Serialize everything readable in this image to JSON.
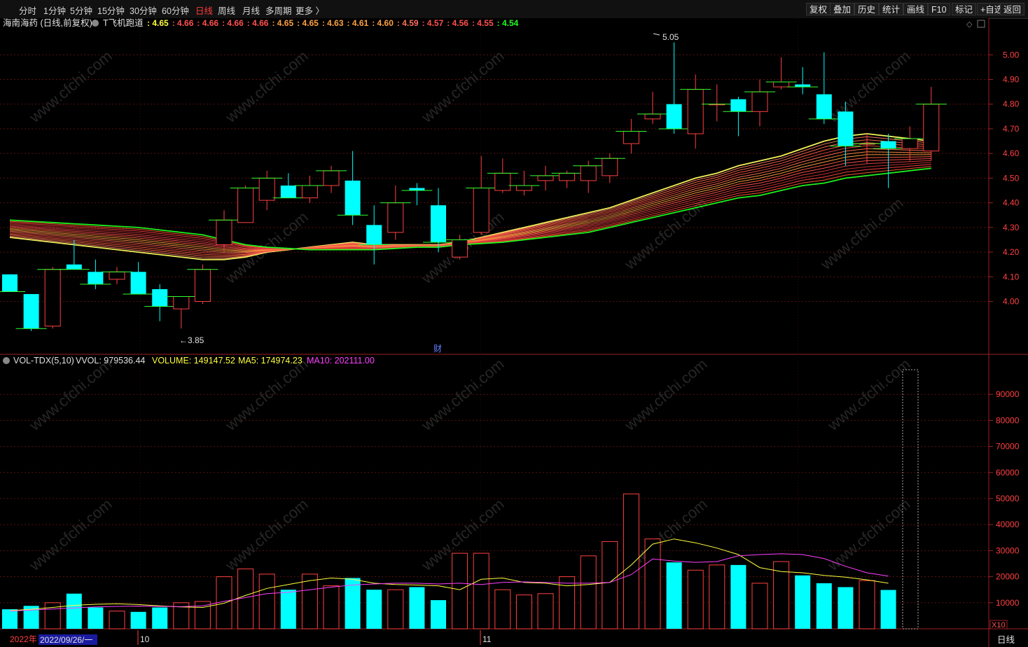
{
  "toolbar": {
    "periods": [
      "分时",
      "1分钟",
      "5分钟",
      "15分钟",
      "30分钟",
      "60分钟",
      "日线",
      "周线",
      "月线",
      "多周期",
      "更多 〉"
    ],
    "active_period": "日线",
    "right_buttons": [
      "复权",
      "叠加",
      "历史",
      "统计",
      "画线",
      "F10",
      "标记",
      "+自选",
      "返回"
    ]
  },
  "main_header": {
    "stock": "海南海药 (日线,前复权)",
    "indicator": "T飞机跑道",
    "values": [
      {
        "v": ": 4.65",
        "color": "#ffff40"
      },
      {
        "v": ": 4.66",
        "color": "#ff5050"
      },
      {
        "v": ": 4.66",
        "color": "#ff5050"
      },
      {
        "v": ": 4.66",
        "color": "#ff5050"
      },
      {
        "v": ": 4.66",
        "color": "#ff5050"
      },
      {
        "v": ": 4.65",
        "color": "#ffa040"
      },
      {
        "v": ": 4.65",
        "color": "#ffa040"
      },
      {
        "v": ": 4.63",
        "color": "#ffa040"
      },
      {
        "v": ": 4.61",
        "color": "#ffa040"
      },
      {
        "v": ": 4.60",
        "color": "#ffa040"
      },
      {
        "v": ": 4.59",
        "color": "#ff7060"
      },
      {
        "v": ": 4.57",
        "color": "#ff5050"
      },
      {
        "v": ": 4.56",
        "color": "#ff5050"
      },
      {
        "v": ": 4.55",
        "color": "#ff5050"
      },
      {
        "v": ": 4.54",
        "color": "#20ff20"
      }
    ]
  },
  "vol_header": {
    "name": "VOL-TDX(5,10)",
    "vvol": "VVOL: 979536.44",
    "volume": "VOLUME: 149147.52",
    "ma5": "MA5: 174974.23",
    "ma10": "MA10: 202111.00"
  },
  "annotations": {
    "high_label": "5.05",
    "low_label": "←3.85",
    "cai_marker": "财",
    "xscale": "X10"
  },
  "footer": {
    "year": "2022年",
    "date": "2022/09/26/一",
    "oct": "10",
    "nov": "11",
    "period_btn": "日线"
  },
  "colors": {
    "up": "#ff4040",
    "down": "#00ffff",
    "ma5": "#ffff40",
    "ma10": "#ff40ff",
    "fast_line": "#ffff60",
    "slow_line": "#20ff20"
  },
  "chart_data": [
    {
      "type": "candlestick",
      "ylim": [
        3.8,
        5.12
      ],
      "yticks": [
        4.0,
        4.1,
        4.2,
        4.3,
        4.4,
        4.5,
        4.6,
        4.7,
        4.8,
        4.9,
        5.0
      ],
      "candles": [
        {
          "o": 4.11,
          "h": 4.11,
          "l": 4.04,
          "c": 4.04
        },
        {
          "o": 4.03,
          "h": 4.03,
          "l": 3.88,
          "c": 3.89
        },
        {
          "o": 3.9,
          "h": 4.14,
          "l": 3.89,
          "c": 4.13
        },
        {
          "o": 4.15,
          "h": 4.25,
          "l": 4.13,
          "c": 4.13
        },
        {
          "o": 4.12,
          "h": 4.17,
          "l": 4.05,
          "c": 4.07
        },
        {
          "o": 4.09,
          "h": 4.14,
          "l": 4.07,
          "c": 4.12
        },
        {
          "o": 4.12,
          "h": 4.16,
          "l": 4.03,
          "c": 4.03
        },
        {
          "o": 4.05,
          "h": 4.07,
          "l": 3.92,
          "c": 3.98
        },
        {
          "o": 3.97,
          "h": 4.02,
          "l": 3.89,
          "c": 4.02
        },
        {
          "o": 4.0,
          "h": 4.15,
          "l": 3.99,
          "c": 4.13
        },
        {
          "o": 4.23,
          "h": 4.37,
          "l": 4.2,
          "c": 4.33
        },
        {
          "o": 4.32,
          "h": 4.47,
          "l": 4.32,
          "c": 4.46
        },
        {
          "o": 4.41,
          "h": 4.53,
          "l": 4.37,
          "c": 4.5
        },
        {
          "o": 4.47,
          "h": 4.52,
          "l": 4.42,
          "c": 4.42
        },
        {
          "o": 4.42,
          "h": 4.51,
          "l": 4.4,
          "c": 4.47
        },
        {
          "o": 4.47,
          "h": 4.55,
          "l": 4.44,
          "c": 4.53
        },
        {
          "o": 4.49,
          "h": 4.61,
          "l": 4.31,
          "c": 4.35
        },
        {
          "o": 4.31,
          "h": 4.39,
          "l": 4.15,
          "c": 4.23
        },
        {
          "o": 4.28,
          "h": 4.47,
          "l": 4.25,
          "c": 4.4
        },
        {
          "o": 4.46,
          "h": 4.48,
          "l": 4.39,
          "c": 4.45
        },
        {
          "o": 4.39,
          "h": 4.46,
          "l": 4.2,
          "c": 4.24
        },
        {
          "o": 4.18,
          "h": 4.27,
          "l": 4.17,
          "c": 4.25
        },
        {
          "o": 4.28,
          "h": 4.59,
          "l": 4.27,
          "c": 4.46
        },
        {
          "o": 4.45,
          "h": 4.58,
          "l": 4.44,
          "c": 4.52
        },
        {
          "o": 4.45,
          "h": 4.53,
          "l": 4.43,
          "c": 4.47
        },
        {
          "o": 4.49,
          "h": 4.55,
          "l": 4.45,
          "c": 4.51
        },
        {
          "o": 4.49,
          "h": 4.53,
          "l": 4.46,
          "c": 4.52
        },
        {
          "o": 4.49,
          "h": 4.57,
          "l": 4.44,
          "c": 4.55
        },
        {
          "o": 4.51,
          "h": 4.6,
          "l": 4.48,
          "c": 4.58
        },
        {
          "o": 4.64,
          "h": 4.74,
          "l": 4.6,
          "c": 4.69
        },
        {
          "o": 4.74,
          "h": 4.85,
          "l": 4.72,
          "c": 4.76
        },
        {
          "o": 4.8,
          "h": 5.05,
          "l": 4.68,
          "c": 4.7
        },
        {
          "o": 4.68,
          "h": 4.92,
          "l": 4.62,
          "c": 4.86
        },
        {
          "o": 4.8,
          "h": 4.88,
          "l": 4.73,
          "c": 4.8
        },
        {
          "o": 4.82,
          "h": 4.83,
          "l": 4.67,
          "c": 4.77
        },
        {
          "o": 4.77,
          "h": 4.9,
          "l": 4.71,
          "c": 4.85
        },
        {
          "o": 4.87,
          "h": 4.99,
          "l": 4.86,
          "c": 4.89
        },
        {
          "o": 4.88,
          "h": 4.95,
          "l": 4.84,
          "c": 4.87
        },
        {
          "o": 4.84,
          "h": 5.01,
          "l": 4.72,
          "c": 4.74
        },
        {
          "o": 4.77,
          "h": 4.81,
          "l": 4.55,
          "c": 4.63
        },
        {
          "o": 4.64,
          "h": 4.68,
          "l": 4.56,
          "c": 4.64
        },
        {
          "o": 4.65,
          "h": 4.68,
          "l": 4.46,
          "c": 4.62
        },
        {
          "o": 4.62,
          "h": 4.71,
          "l": 4.57,
          "c": 4.66
        },
        {
          "o": 4.61,
          "h": 4.87,
          "l": 4.57,
          "c": 4.8
        }
      ],
      "fast_line": [
        4.26,
        4.25,
        4.24,
        4.23,
        4.22,
        4.21,
        4.2,
        4.19,
        4.18,
        4.17,
        4.17,
        4.18,
        4.2,
        4.21,
        4.22,
        4.23,
        4.24,
        4.23,
        4.23,
        4.23,
        4.23,
        4.24,
        4.26,
        4.28,
        4.3,
        4.32,
        4.34,
        4.36,
        4.38,
        4.41,
        4.44,
        4.47,
        4.5,
        4.52,
        4.55,
        4.57,
        4.59,
        4.62,
        4.65,
        4.67,
        4.68,
        4.67,
        4.66,
        4.65
      ],
      "slow_line": [
        4.33,
        4.325,
        4.32,
        4.315,
        4.31,
        4.305,
        4.3,
        4.29,
        4.28,
        4.27,
        4.25,
        4.23,
        4.22,
        4.215,
        4.21,
        4.21,
        4.21,
        4.21,
        4.215,
        4.22,
        4.22,
        4.23,
        4.235,
        4.24,
        4.25,
        4.26,
        4.27,
        4.28,
        4.3,
        4.32,
        4.34,
        4.36,
        4.38,
        4.4,
        4.42,
        4.43,
        4.45,
        4.47,
        4.48,
        4.5,
        4.51,
        4.52,
        4.53,
        4.54
      ]
    },
    {
      "type": "bar",
      "ylim": [
        0,
        100000
      ],
      "yticks": [
        10000,
        20000,
        30000,
        40000,
        50000,
        60000,
        70000,
        80000,
        90000
      ],
      "volumes": [
        7500,
        8800,
        10000,
        13500,
        8200,
        6800,
        6500,
        8200,
        10000,
        10500,
        20000,
        23000,
        21000,
        15000,
        21000,
        16500,
        19500,
        15000,
        15000,
        16000,
        11000,
        29000,
        29000,
        15000,
        13000,
        13500,
        20000,
        28000,
        33500,
        51800,
        34500,
        25500,
        22500,
        24500,
        24500,
        17500,
        25800,
        20500,
        17500,
        16000,
        18500,
        14915
      ],
      "vol_ma5": [
        7000,
        7500,
        8200,
        9000,
        9400,
        9600,
        9300,
        8800,
        8400,
        8200,
        9800,
        12800,
        15500,
        17000,
        18500,
        19500,
        19000,
        17500,
        17000,
        16800,
        16500,
        15000,
        19000,
        19500,
        17800,
        17500,
        16500,
        17000,
        17800,
        24500,
        32500,
        34500,
        33000,
        31000,
        28500,
        23500,
        22000,
        21500,
        20500,
        19800,
        18800,
        17497
      ],
      "vol_ma10": [
        6800,
        7200,
        7600,
        8000,
        8400,
        8600,
        8700,
        8600,
        8500,
        8800,
        10500,
        12000,
        13500,
        14000,
        15000,
        16000,
        16800,
        17200,
        17500,
        17500,
        17200,
        17500,
        17000,
        17800,
        18000,
        17800,
        17500,
        17500,
        17800,
        20800,
        26800,
        26000,
        25500,
        25800,
        28000,
        28500,
        28800,
        28500,
        27000,
        24000,
        21500,
        20211
      ]
    }
  ]
}
